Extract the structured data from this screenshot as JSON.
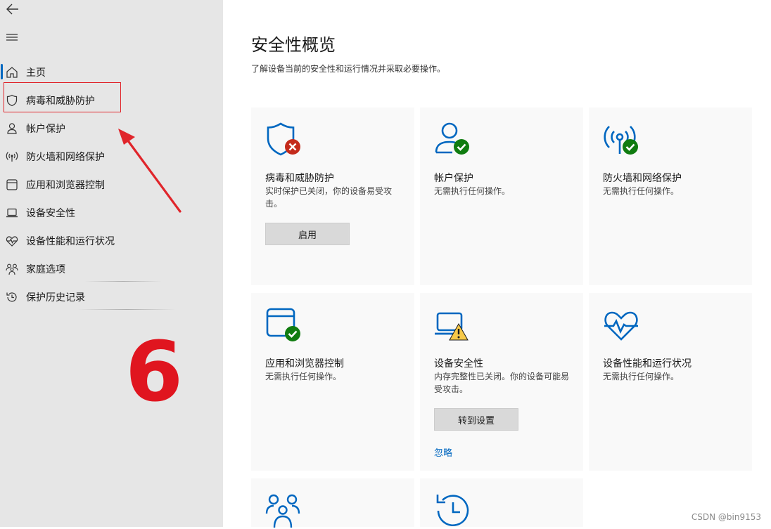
{
  "sidebar": {
    "items": [
      {
        "label": "主页",
        "icon": "home-icon"
      },
      {
        "label": "病毒和威胁防护",
        "icon": "shield-icon"
      },
      {
        "label": "帐户保护",
        "icon": "person-icon"
      },
      {
        "label": "防火墙和网络保护",
        "icon": "wifi-antenna-icon"
      },
      {
        "label": "应用和浏览器控制",
        "icon": "app-window-icon"
      },
      {
        "label": "设备安全性",
        "icon": "laptop-icon"
      },
      {
        "label": "设备性能和运行状况",
        "icon": "heart-pulse-icon"
      },
      {
        "label": "家庭选项",
        "icon": "family-icon"
      },
      {
        "label": "保护历史记录",
        "icon": "history-icon"
      }
    ],
    "annotation_number": "6"
  },
  "main": {
    "title": "安全性概览",
    "subtitle": "了解设备当前的安全性和运行情况并采取必要操作。",
    "cards": [
      {
        "title": "病毒和威胁防护",
        "desc": "实时保护已关闭，你的设备易受攻击。",
        "button": "启用",
        "status": "error",
        "icon": "shield-icon"
      },
      {
        "title": "帐户保护",
        "desc": "无需执行任何操作。",
        "status": "ok",
        "icon": "person-icon"
      },
      {
        "title": "防火墙和网络保护",
        "desc": "无需执行任何操作。",
        "status": "ok",
        "icon": "wifi-antenna-icon"
      },
      {
        "title": "应用和浏览器控制",
        "desc": "无需执行任何操作。",
        "status": "ok",
        "icon": "app-window-icon"
      },
      {
        "title": "设备安全性",
        "desc": "内存完整性已关闭。你的设备可能易受攻击。",
        "button": "转到设置",
        "link": "忽略",
        "status": "warning",
        "icon": "laptop-icon"
      },
      {
        "title": "设备性能和运行状况",
        "desc": "无需执行任何操作。",
        "status": "none",
        "icon": "heart-pulse-icon"
      },
      {
        "title": "",
        "desc": "",
        "icon": "family-icon"
      },
      {
        "title": "",
        "desc": "",
        "icon": "history-icon"
      }
    ]
  },
  "watermark": "CSDN @bin9153",
  "colors": {
    "accent": "#0067c0",
    "ok": "#107c10",
    "error": "#c42b1c",
    "warning": "#f7c948",
    "annotation": "#e0151f"
  }
}
